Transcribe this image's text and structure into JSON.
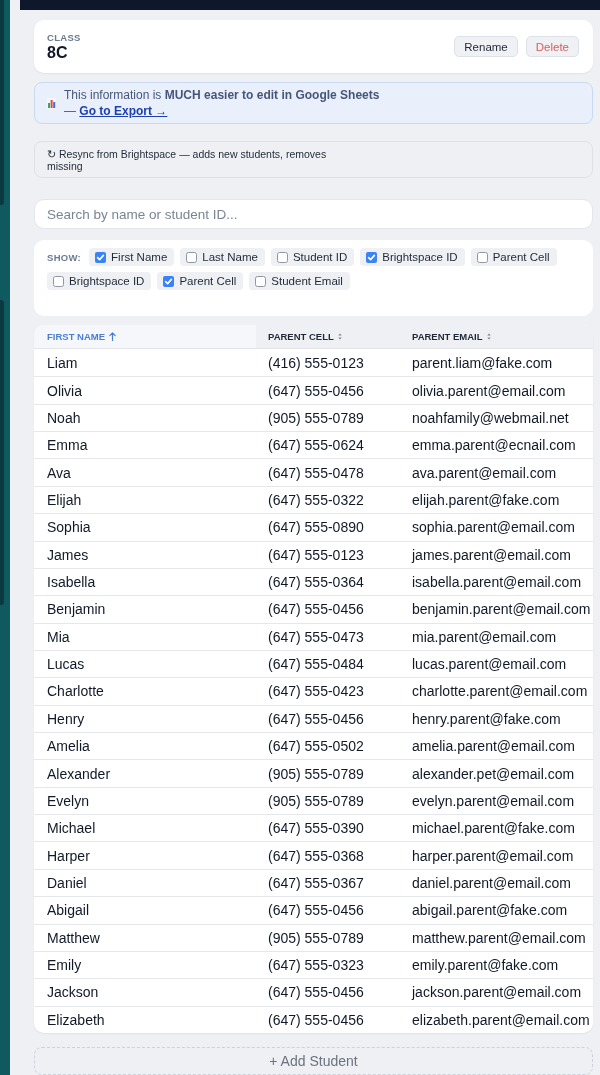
{
  "class_card": {
    "label": "CLASS",
    "name": "8C",
    "buttons": [
      {
        "label": "Rename",
        "kind": "default"
      },
      {
        "label": "Delete",
        "kind": "danger"
      }
    ]
  },
  "banner": {
    "text": "This information is **MUCH easier to edit in Google Sheets**",
    "link_prefix": "—",
    "link": "Go to Export →"
  },
  "resync": {
    "label": "↻ Resync from Brightspace — adds new students, removes missing"
  },
  "search": {
    "placeholder": "Search by name or student ID..."
  },
  "column_filter": {
    "label": "SHOW:",
    "options": [
      {
        "label": "First Name",
        "checked": true
      },
      {
        "label": "Last Name",
        "checked": false
      },
      {
        "label": "Student ID",
        "checked": false
      },
      {
        "label": "Brightspace ID",
        "checked": true
      },
      {
        "label": "Parent Cell",
        "checked": false
      },
      {
        "label": "Brightspace ID",
        "checked": false
      },
      {
        "label": "Parent Cell",
        "checked": true
      },
      {
        "label": "Student Email",
        "checked": false
      }
    ]
  },
  "table": {
    "columns": [
      {
        "label": "FIRST NAME",
        "sorted": true
      },
      {
        "label": "PARENT CELL",
        "sorted": false
      },
      {
        "label": "PARENT EMAIL",
        "sorted": false
      }
    ],
    "rows": [
      [
        "Liam",
        "(416) 555-0123",
        "parent.liam@fake.com"
      ],
      [
        "Olivia",
        "(647) 555-0456",
        "olivia.parent@email.com"
      ],
      [
        "Noah",
        "(905) 555-0789",
        "noahfamily@webmail.net"
      ],
      [
        "Emma",
        "(647) 555-0624",
        "emma.parent@ecnail.com"
      ],
      [
        "Ava",
        "(647) 555-0478",
        "ava.parent@email.com"
      ],
      [
        "Elijah",
        "(647) 555-0322",
        "elijah.parent@fake.com"
      ],
      [
        "Sophia",
        "(647) 555-0890",
        "sophia.parent@email.com"
      ],
      [
        "James",
        "(647) 555-0123",
        "james.parent@email.com"
      ],
      [
        "Isabella",
        "(647) 555-0364",
        "isabella.parent@email.com"
      ],
      [
        "Benjamin",
        "(647) 555-0456",
        "benjamin.parent@email.com"
      ],
      [
        "Mia",
        "(647) 555-0473",
        "mia.parent@email.com"
      ],
      [
        "Lucas",
        "(647) 555-0484",
        "lucas.parent@email.com"
      ],
      [
        "Charlotte",
        "(647) 555-0423",
        "charlotte.parent@email.com"
      ],
      [
        "Henry",
        "(647) 555-0456",
        "henry.parent@fake.com"
      ],
      [
        "Amelia",
        "(647) 555-0502",
        "amelia.parent@email.com"
      ],
      [
        "Alexander",
        "(905) 555-0789",
        "alexander.pet@email.com"
      ],
      [
        "Evelyn",
        "(905) 555-0789",
        "evelyn.parent@email.com"
      ],
      [
        "Michael",
        "(647) 555-0390",
        "michael.parent@fake.com"
      ],
      [
        "Harper",
        "(647) 555-0368",
        "harper.parent@email.com"
      ],
      [
        "Daniel",
        "(647) 555-0367",
        "daniel.parent@email.com"
      ],
      [
        "Abigail",
        "(647) 555-0456",
        "abigail.parent@fake.com"
      ],
      [
        "Matthew",
        "(905) 555-0789",
        "matthew.parent@email.com"
      ],
      [
        "Emily",
        "(647) 555-0323",
        "emily.parent@fake.com"
      ],
      [
        "Jackson",
        "(647) 555-0456",
        "jackson.parent@email.com"
      ],
      [
        "Elizabeth",
        "(647) 555-0456",
        "elizabeth.parent@email.com"
      ]
    ]
  },
  "add_button": {
    "label": "+ Add Student"
  }
}
